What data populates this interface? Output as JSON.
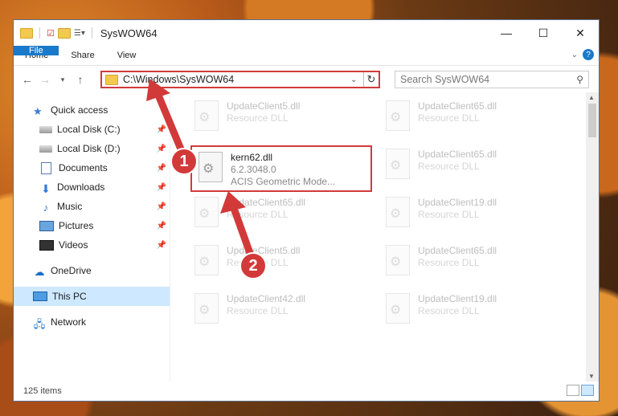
{
  "window": {
    "title": "SysWOW64",
    "controls": {
      "minimize": "—",
      "maximize": "☐",
      "close": "✕"
    }
  },
  "ribbon": {
    "tabs": [
      "File",
      "Home",
      "Share",
      "View"
    ]
  },
  "address": {
    "path": "C:\\Windows\\SysWOW64",
    "search_placeholder": "Search SysWOW64"
  },
  "sidebar": {
    "items": [
      {
        "label": "Quick access"
      },
      {
        "label": "Local Disk (C:)"
      },
      {
        "label": "Local Disk (D:)"
      },
      {
        "label": "Documents"
      },
      {
        "label": "Downloads"
      },
      {
        "label": "Music"
      },
      {
        "label": "Pictures"
      },
      {
        "label": "Videos"
      },
      {
        "label": "OneDrive"
      },
      {
        "label": "This PC"
      },
      {
        "label": "Network"
      }
    ]
  },
  "files": {
    "selected": {
      "name": "kern62.dll",
      "version": "6.2.3048.0",
      "description": "ACIS Geometric Mode..."
    },
    "items": [
      {
        "name": "UpdateClient5.dll",
        "type": "Resource DLL"
      },
      {
        "name": "UpdateClient65.dll",
        "type": "Resource DLL"
      },
      {
        "name": "UpdateClient65.dll",
        "type": "Resource DLL"
      },
      {
        "name": "UpdateClient65.dll",
        "type": "Resource DLL"
      },
      {
        "name": "UpdateClient19.dll",
        "type": "Resource DLL"
      },
      {
        "name": "UpdateClient5.dll",
        "type": "Resource DLL"
      },
      {
        "name": "UpdateClient65.dll",
        "type": "Resource DLL"
      },
      {
        "name": "UpdateClient42.dll",
        "type": "Resource DLL"
      },
      {
        "name": "UpdateClient19.dll",
        "type": "Resource DLL"
      }
    ]
  },
  "status": {
    "count": "125 items"
  },
  "annotations": {
    "step1": "1",
    "step2": "2"
  },
  "colors": {
    "accent": "#1979ca",
    "highlight": "#d23a3a"
  }
}
